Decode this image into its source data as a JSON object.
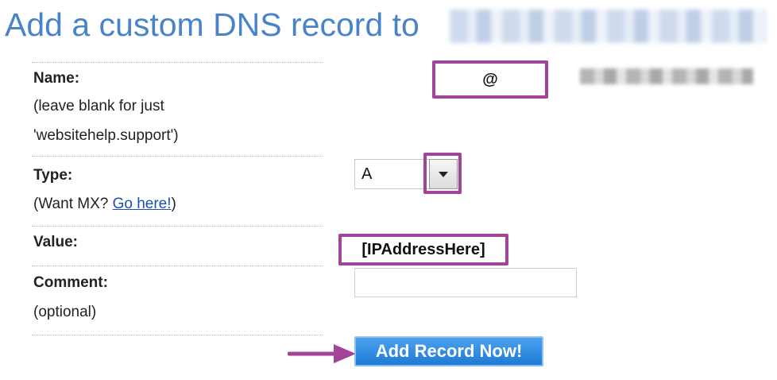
{
  "title": "Add a custom DNS record to",
  "colors": {
    "title": "#4a84c8",
    "highlight": "#a2449a",
    "button": "#2c8ae0",
    "link": "#1b4fb0"
  },
  "form": {
    "name": {
      "label": "Name:",
      "note_line1": "(leave blank for just",
      "note_line2": "'websitehelp.support')",
      "value": "@"
    },
    "type": {
      "label": "Type:",
      "note_prefix": "(Want MX? ",
      "link": "Go here!",
      "note_suffix": ")",
      "value": "A"
    },
    "value": {
      "label": "Value:",
      "value": "[IPAddressHere]"
    },
    "comment": {
      "label": "Comment:",
      "note": "(optional)",
      "value": ""
    },
    "submit_label": "Add Record Now!"
  },
  "icons": {
    "dropdown": "triangle-down-icon",
    "pointer": "arrow-right-icon"
  }
}
